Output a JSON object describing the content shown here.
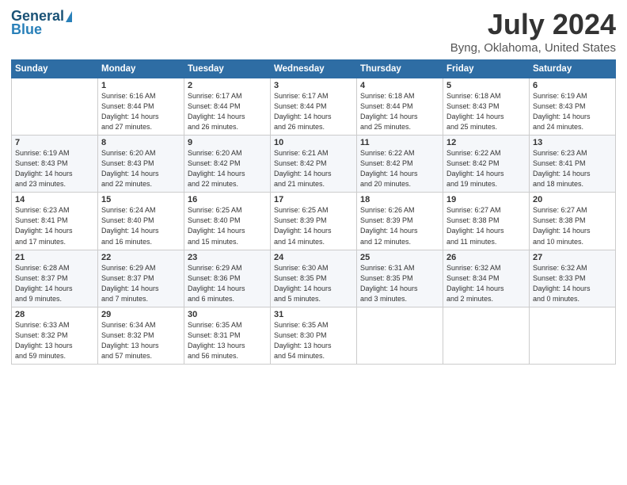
{
  "header": {
    "logo_general": "General",
    "logo_blue": "Blue",
    "title": "July 2024",
    "subtitle": "Byng, Oklahoma, United States"
  },
  "days_of_week": [
    "Sunday",
    "Monday",
    "Tuesday",
    "Wednesday",
    "Thursday",
    "Friday",
    "Saturday"
  ],
  "weeks": [
    [
      {
        "day": "",
        "info": ""
      },
      {
        "day": "1",
        "info": "Sunrise: 6:16 AM\nSunset: 8:44 PM\nDaylight: 14 hours\nand 27 minutes."
      },
      {
        "day": "2",
        "info": "Sunrise: 6:17 AM\nSunset: 8:44 PM\nDaylight: 14 hours\nand 26 minutes."
      },
      {
        "day": "3",
        "info": "Sunrise: 6:17 AM\nSunset: 8:44 PM\nDaylight: 14 hours\nand 26 minutes."
      },
      {
        "day": "4",
        "info": "Sunrise: 6:18 AM\nSunset: 8:44 PM\nDaylight: 14 hours\nand 25 minutes."
      },
      {
        "day": "5",
        "info": "Sunrise: 6:18 AM\nSunset: 8:43 PM\nDaylight: 14 hours\nand 25 minutes."
      },
      {
        "day": "6",
        "info": "Sunrise: 6:19 AM\nSunset: 8:43 PM\nDaylight: 14 hours\nand 24 minutes."
      }
    ],
    [
      {
        "day": "7",
        "info": "Sunrise: 6:19 AM\nSunset: 8:43 PM\nDaylight: 14 hours\nand 23 minutes."
      },
      {
        "day": "8",
        "info": "Sunrise: 6:20 AM\nSunset: 8:43 PM\nDaylight: 14 hours\nand 22 minutes."
      },
      {
        "day": "9",
        "info": "Sunrise: 6:20 AM\nSunset: 8:42 PM\nDaylight: 14 hours\nand 22 minutes."
      },
      {
        "day": "10",
        "info": "Sunrise: 6:21 AM\nSunset: 8:42 PM\nDaylight: 14 hours\nand 21 minutes."
      },
      {
        "day": "11",
        "info": "Sunrise: 6:22 AM\nSunset: 8:42 PM\nDaylight: 14 hours\nand 20 minutes."
      },
      {
        "day": "12",
        "info": "Sunrise: 6:22 AM\nSunset: 8:42 PM\nDaylight: 14 hours\nand 19 minutes."
      },
      {
        "day": "13",
        "info": "Sunrise: 6:23 AM\nSunset: 8:41 PM\nDaylight: 14 hours\nand 18 minutes."
      }
    ],
    [
      {
        "day": "14",
        "info": "Sunrise: 6:23 AM\nSunset: 8:41 PM\nDaylight: 14 hours\nand 17 minutes."
      },
      {
        "day": "15",
        "info": "Sunrise: 6:24 AM\nSunset: 8:40 PM\nDaylight: 14 hours\nand 16 minutes."
      },
      {
        "day": "16",
        "info": "Sunrise: 6:25 AM\nSunset: 8:40 PM\nDaylight: 14 hours\nand 15 minutes."
      },
      {
        "day": "17",
        "info": "Sunrise: 6:25 AM\nSunset: 8:39 PM\nDaylight: 14 hours\nand 14 minutes."
      },
      {
        "day": "18",
        "info": "Sunrise: 6:26 AM\nSunset: 8:39 PM\nDaylight: 14 hours\nand 12 minutes."
      },
      {
        "day": "19",
        "info": "Sunrise: 6:27 AM\nSunset: 8:38 PM\nDaylight: 14 hours\nand 11 minutes."
      },
      {
        "day": "20",
        "info": "Sunrise: 6:27 AM\nSunset: 8:38 PM\nDaylight: 14 hours\nand 10 minutes."
      }
    ],
    [
      {
        "day": "21",
        "info": "Sunrise: 6:28 AM\nSunset: 8:37 PM\nDaylight: 14 hours\nand 9 minutes."
      },
      {
        "day": "22",
        "info": "Sunrise: 6:29 AM\nSunset: 8:37 PM\nDaylight: 14 hours\nand 7 minutes."
      },
      {
        "day": "23",
        "info": "Sunrise: 6:29 AM\nSunset: 8:36 PM\nDaylight: 14 hours\nand 6 minutes."
      },
      {
        "day": "24",
        "info": "Sunrise: 6:30 AM\nSunset: 8:35 PM\nDaylight: 14 hours\nand 5 minutes."
      },
      {
        "day": "25",
        "info": "Sunrise: 6:31 AM\nSunset: 8:35 PM\nDaylight: 14 hours\nand 3 minutes."
      },
      {
        "day": "26",
        "info": "Sunrise: 6:32 AM\nSunset: 8:34 PM\nDaylight: 14 hours\nand 2 minutes."
      },
      {
        "day": "27",
        "info": "Sunrise: 6:32 AM\nSunset: 8:33 PM\nDaylight: 14 hours\nand 0 minutes."
      }
    ],
    [
      {
        "day": "28",
        "info": "Sunrise: 6:33 AM\nSunset: 8:32 PM\nDaylight: 13 hours\nand 59 minutes."
      },
      {
        "day": "29",
        "info": "Sunrise: 6:34 AM\nSunset: 8:32 PM\nDaylight: 13 hours\nand 57 minutes."
      },
      {
        "day": "30",
        "info": "Sunrise: 6:35 AM\nSunset: 8:31 PM\nDaylight: 13 hours\nand 56 minutes."
      },
      {
        "day": "31",
        "info": "Sunrise: 6:35 AM\nSunset: 8:30 PM\nDaylight: 13 hours\nand 54 minutes."
      },
      {
        "day": "",
        "info": ""
      },
      {
        "day": "",
        "info": ""
      },
      {
        "day": "",
        "info": ""
      }
    ]
  ]
}
